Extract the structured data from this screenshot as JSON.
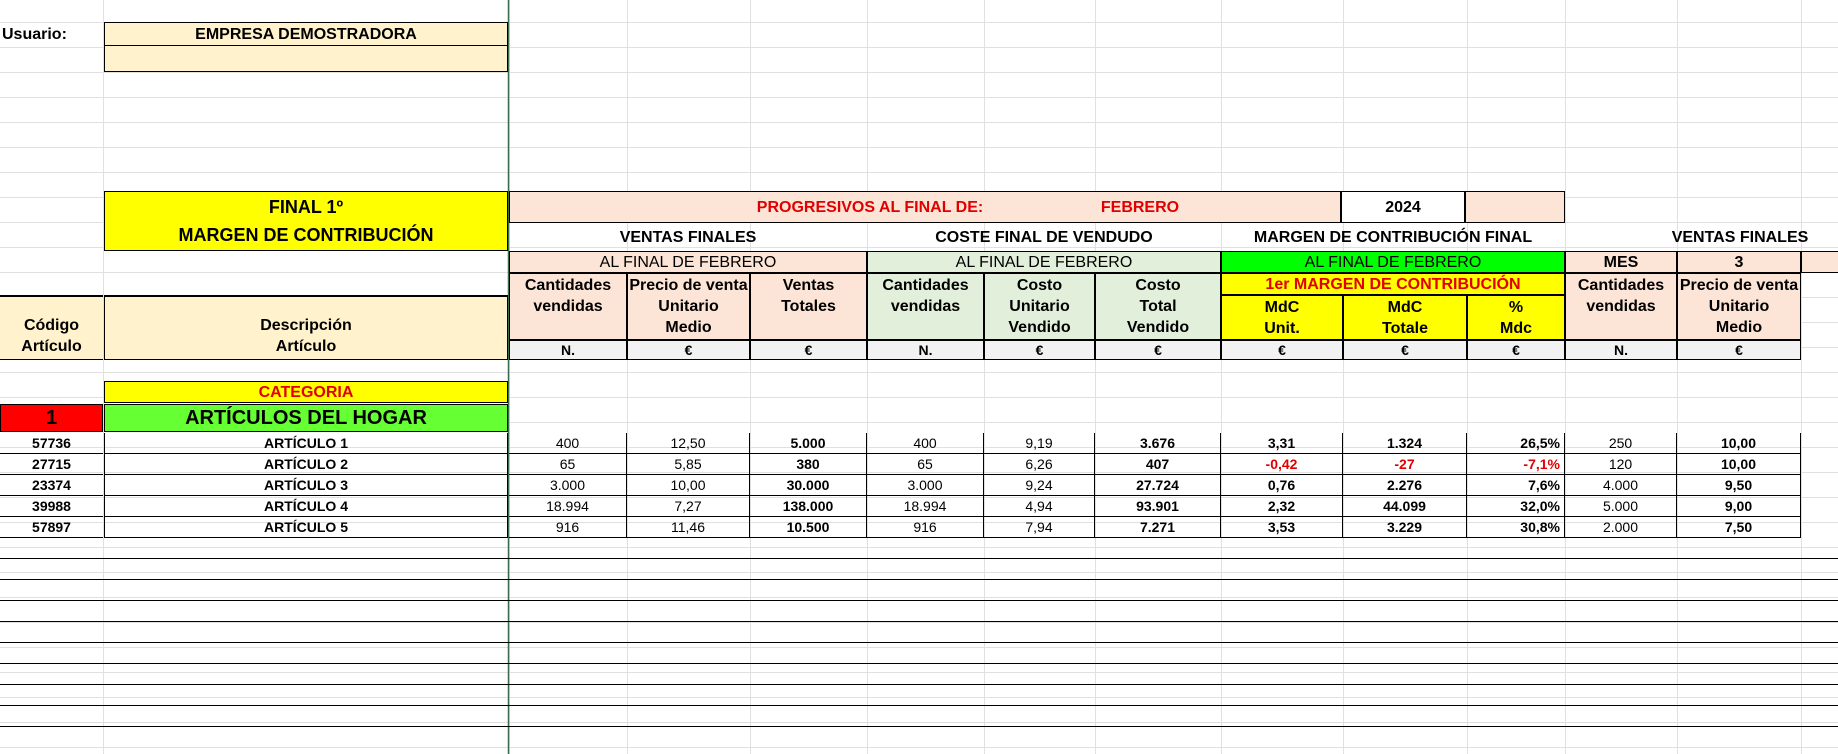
{
  "user": {
    "label": "Usuario:",
    "company": "EMPRESA DEMOSTRADORA"
  },
  "left_header": {
    "title_line1": "FINAL 1º",
    "title_line2": "MARGEN DE CONTRIBUCIÓN",
    "code_line1": "Código",
    "code_line2": "Artículo",
    "desc_line1": "Descripción",
    "desc_line2": "Artículo"
  },
  "progress_bar": {
    "label": "PROGRESIVOS AL FINAL DE:",
    "month": "FEBRERO",
    "year": "2024"
  },
  "sections": {
    "ventas": "VENTAS FINALES",
    "coste": "COSTE FINAL DE VENDUDO",
    "margen": "MARGEN DE CONTRIBUCIÓN FINAL",
    "ventas_mes": "VENTAS FINALES"
  },
  "subheaders": {
    "ventas": "AL FINAL DE FEBRERO",
    "coste": "AL FINAL DE FEBRERO",
    "margen": "AL FINAL DE FEBRERO",
    "mes_label": "MES",
    "mes_value": "3",
    "first_margin": "1er MARGEN DE CONTRIBUCIÓN"
  },
  "columns": [
    {
      "l1": "Cantidades",
      "l2": "vendidas",
      "l3": "",
      "unit": "N."
    },
    {
      "l1": "Precio de venta",
      "l2": "Unitario",
      "l3": "Medio",
      "unit": "€"
    },
    {
      "l1": "Ventas",
      "l2": "Totales",
      "l3": "",
      "unit": "€"
    },
    {
      "l1": "Cantidades",
      "l2": "vendidas",
      "l3": "",
      "unit": "N."
    },
    {
      "l1": "Costo",
      "l2": "Unitario",
      "l3": "Vendido",
      "unit": "€"
    },
    {
      "l1": "Costo",
      "l2": "Total",
      "l3": "Vendido",
      "unit": "€"
    },
    {
      "l1": "",
      "l2": "MdC",
      "l3": "Unit.",
      "unit": "€"
    },
    {
      "l1": "",
      "l2": "MdC",
      "l3": "Totale",
      "unit": "€"
    },
    {
      "l1": "",
      "l2": "%",
      "l3": "Mdc",
      "unit": "€"
    },
    {
      "l1": "Cantidades",
      "l2": "vendidas",
      "l3": "",
      "unit": "N."
    },
    {
      "l1": "Precio de venta",
      "l2": "Unitario",
      "l3": "Medio",
      "unit": "€"
    }
  ],
  "category": {
    "label": "CATEGORIA",
    "number": "1",
    "name": "ARTÍCULOS DEL HOGAR"
  },
  "rows": [
    {
      "code": "57736",
      "desc": "ARTÍCULO 1",
      "v": [
        "400",
        "12,50",
        "5.000",
        "400",
        "9,19",
        "3.676",
        "3,31",
        "1.324",
        "26,5%",
        "250",
        "10,00"
      ]
    },
    {
      "code": "27715",
      "desc": "ARTÍCULO 2",
      "v": [
        "65",
        "5,85",
        "380",
        "65",
        "6,26",
        "407",
        "-0,42",
        "-27",
        "-7,1%",
        "120",
        "10,00"
      ]
    },
    {
      "code": "23374",
      "desc": "ARTÍCULO 3",
      "v": [
        "3.000",
        "10,00",
        "30.000",
        "3.000",
        "9,24",
        "27.724",
        "0,76",
        "2.276",
        "7,6%",
        "4.000",
        "9,50"
      ]
    },
    {
      "code": "39988",
      "desc": "ARTÍCULO 4",
      "v": [
        "18.994",
        "7,27",
        "138.000",
        "18.994",
        "4,94",
        "93.901",
        "2,32",
        "44.099",
        "32,0%",
        "5.000",
        "9,00"
      ]
    },
    {
      "code": "57897",
      "desc": "ARTÍCULO 5",
      "v": [
        "916",
        "11,46",
        "10.500",
        "916",
        "7,94",
        "7.271",
        "3,53",
        "3.229",
        "30,8%",
        "2.000",
        "7,50"
      ]
    }
  ],
  "colors": {
    "peach": "#fce4d6",
    "green_light": "#e2efda",
    "yellow": "#ffff00",
    "green_bright": "#00ff00",
    "green_cat": "#66ff33",
    "red": "#ff0000",
    "grey": "#f2f2f2",
    "cream": "#fff2cc"
  }
}
